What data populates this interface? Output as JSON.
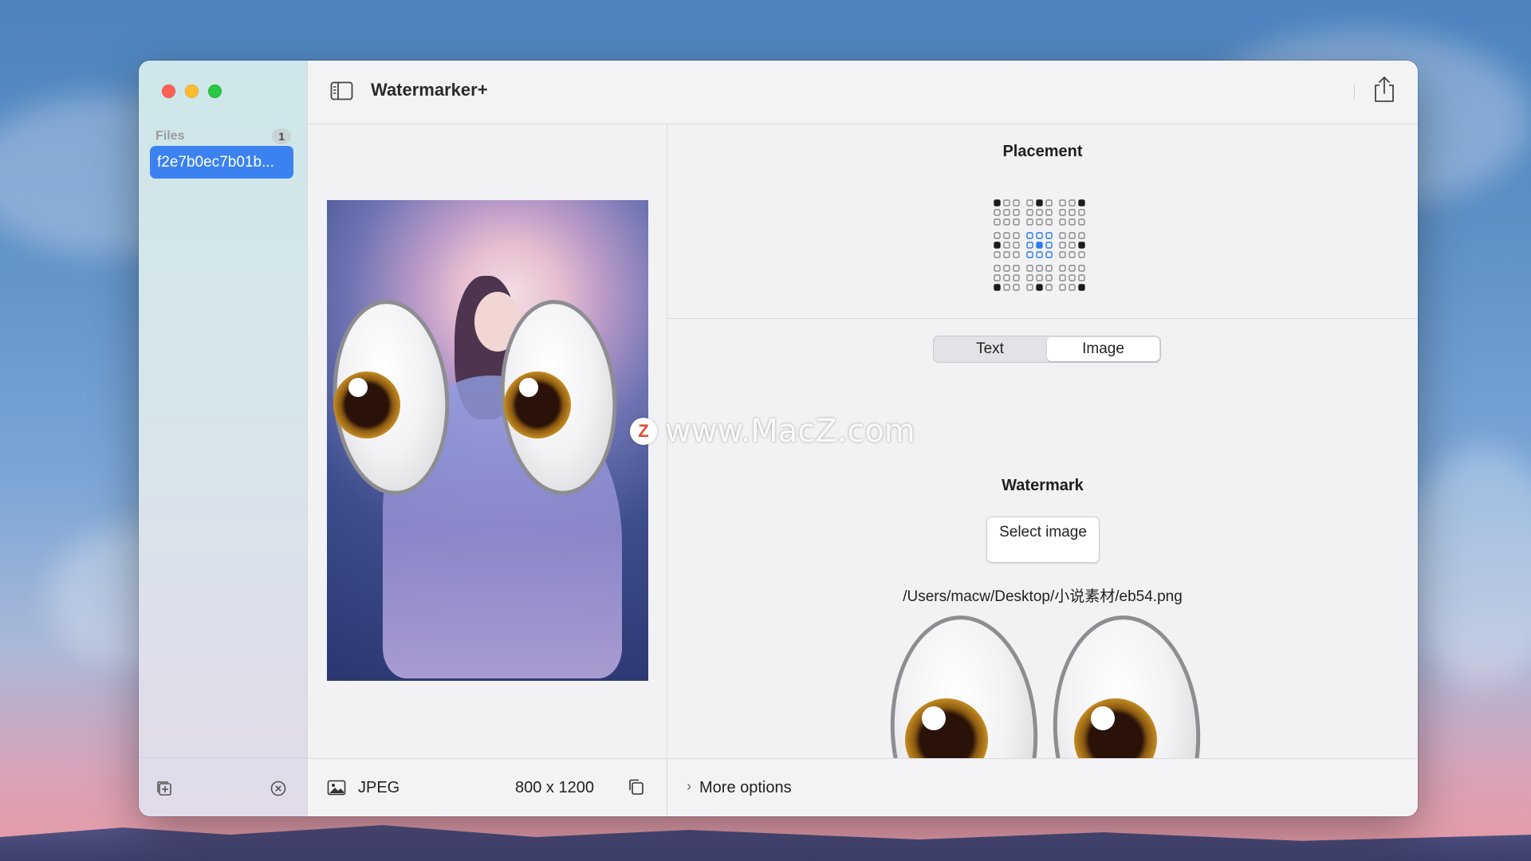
{
  "app": {
    "title": "Watermarker+"
  },
  "sidebar": {
    "section_label": "Files",
    "file_count": "1",
    "files": [
      {
        "name": "f2e7b0ec7b01b..."
      }
    ]
  },
  "preview": {
    "format": "JPEG",
    "dimensions": "800 x 1200"
  },
  "placement": {
    "title": "Placement"
  },
  "watermark_mode": {
    "options": [
      "Text",
      "Image"
    ],
    "selected": "Image"
  },
  "watermark": {
    "title": "Watermark",
    "select_label": "Select image",
    "path": "/Users/macw/Desktop/小说素材/eb54.png"
  },
  "footer": {
    "more_options": "More options"
  },
  "overlay": {
    "badge": "Z",
    "text": "www.MacZ.com"
  },
  "icons": {
    "sidebar_toggle": "sidebar-icon",
    "share": "share-icon",
    "add_file": "add-file-icon",
    "remove_file": "remove-icon",
    "image_format": "image-icon",
    "copy": "copy-icon",
    "chevron": "chevron-right-icon"
  },
  "colors": {
    "accent": "#3b82f0",
    "grid_active": "#2b7de9",
    "grid_dark": "#1c1c1e"
  }
}
